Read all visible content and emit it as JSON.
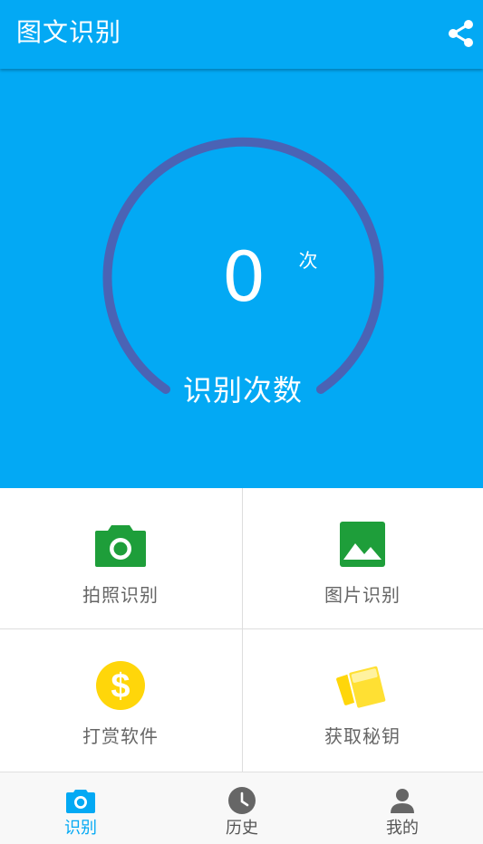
{
  "appbar": {
    "title": "图文识别",
    "share_icon": "share-icon"
  },
  "counter": {
    "value": "0",
    "unit": "次",
    "label": "识别次数"
  },
  "features": [
    {
      "label": "拍照识别",
      "icon": "camera-icon",
      "color": "#1e9e3a"
    },
    {
      "label": "图片识别",
      "icon": "image-icon",
      "color": "#1e9e3a"
    },
    {
      "label": "打赏软件",
      "icon": "dollar-icon",
      "color": "#ffd60a"
    },
    {
      "label": "获取秘钥",
      "icon": "key-cards-icon",
      "color": "#ffd60a"
    }
  ],
  "bottom_nav": [
    {
      "label": "识别",
      "icon": "camera-icon",
      "active": true
    },
    {
      "label": "历史",
      "icon": "clock-icon",
      "active": false
    },
    {
      "label": "我的",
      "icon": "person-icon",
      "active": false
    }
  ],
  "colors": {
    "primary": "#03a9f4",
    "gauge_arc": "#4a63b5",
    "active_tab": "#03a9f4"
  }
}
